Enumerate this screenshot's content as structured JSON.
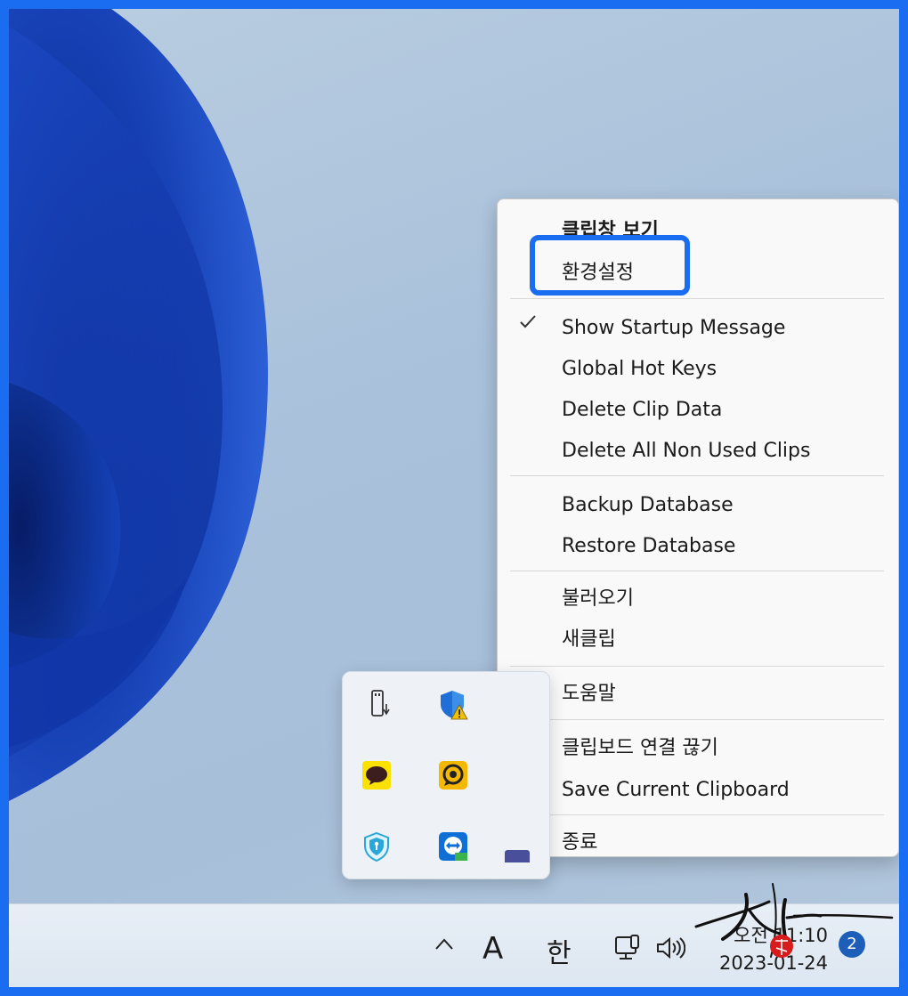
{
  "menu": {
    "items": [
      {
        "label": "클립창 보기",
        "bold": true
      },
      {
        "label": "환경설정",
        "highlighted": true
      },
      {
        "label": "Show Startup Message",
        "checked": true
      },
      {
        "label": "Global Hot Keys"
      },
      {
        "label": "Delete Clip Data"
      },
      {
        "label": "Delete All Non Used Clips"
      },
      {
        "label": "Backup Database"
      },
      {
        "label": "Restore Database"
      },
      {
        "label": "불러오기"
      },
      {
        "label": "새클립"
      },
      {
        "label": "도움말"
      },
      {
        "label": "클립보드 연결 끊기"
      },
      {
        "label": "Save Current Clipboard"
      },
      {
        "label": "종료"
      }
    ]
  },
  "tray": {
    "icons": [
      "usb-drive-icon",
      "security-warning-shield-icon",
      "kakaotalk-icon",
      "remote-desktop-icon",
      "shield-protection-icon",
      "teamviewer-icon"
    ]
  },
  "taskbar": {
    "chevron": "show-hidden-icons",
    "ime_mode": "A",
    "ime_lang": "한",
    "time": "오전 11:10",
    "date": "2023-01-24",
    "notification_count": "2"
  },
  "colors": {
    "accent": "#1a6cf0",
    "badge": "#1d5fb8"
  }
}
